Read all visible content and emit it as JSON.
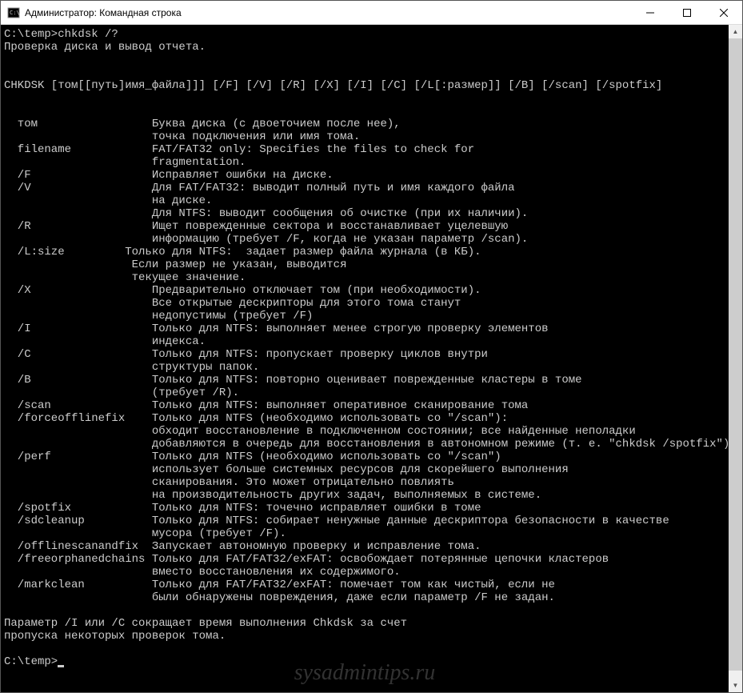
{
  "window": {
    "title": "Администратор: Командная строка"
  },
  "terminal": {
    "prompt1": "C:\\temp>chkdsk /?",
    "desc": "Проверка диска и вывод отчета.",
    "syntax": "CHKDSK [том[[путь]имя_файла]]] [/F] [/V] [/R] [/X] [/I] [/C] [/L[:размер]] [/B] [/scan] [/spotfix]",
    "params": [
      {
        "name": "  том",
        "desc": [
          "Буква диска (с двоеточием после нее),",
          "точка подключения или имя тома."
        ]
      },
      {
        "name": "  filename",
        "desc": [
          "FAT/FAT32 only: Specifies the files to check for",
          "fragmentation."
        ]
      },
      {
        "name": "  /F",
        "desc": [
          "Исправляет ошибки на диске."
        ]
      },
      {
        "name": "  /V",
        "desc": [
          "Для FAT/FAT32: выводит полный путь и имя каждого файла",
          "на диске.",
          "Для NTFS: выводит сообщения об очистке (при их наличии)."
        ]
      },
      {
        "name": "  /R",
        "desc": [
          "Ищет поврежденные сектора и восстанавливает уцелевшую",
          "информацию (требует /F, когда не указан параметр /scan)."
        ]
      },
      {
        "name": "  /L:size",
        "desc": [
          "Только для NTFS:  задает размер файла журнала (в КБ).",
          " Если размер не указан, выводится",
          " текущее значение."
        ],
        "col": 18
      },
      {
        "name": "  /X",
        "desc": [
          "Предварительно отключает том (при необходимости).",
          "Все открытые дескрипторы для этого тома станут",
          "недопустимы (требует /F)"
        ]
      },
      {
        "name": "  /I",
        "desc": [
          "Только для NTFS: выполняет менее строгую проверку элементов",
          "индекса."
        ]
      },
      {
        "name": "  /C",
        "desc": [
          "Только для NTFS: пропускает проверку циклов внутри",
          "структуры папок."
        ]
      },
      {
        "name": "  /B",
        "desc": [
          "Только для NTFS: повторно оценивает поврежденные кластеры в томе",
          "(требует /R)."
        ]
      },
      {
        "name": "  /scan",
        "desc": [
          "Только для NTFS: выполняет оперативное сканирование тома"
        ]
      },
      {
        "name": "  /forceofflinefix",
        "desc": [
          "Только для NTFS (необходимо использовать со \"/scan\"):",
          "обходит восстановление в подключенном состоянии; все найденные неполадки",
          "добавляются в очередь для восстановления в автономном режиме (т. е. \"chkdsk /spotfix\")."
        ]
      },
      {
        "name": "  /perf",
        "desc": [
          "Только для NTFS (необходимо использовать со \"/scan\")",
          "использует больше системных ресурсов для скорейшего выполнения",
          "сканирования. Это может отрицательно повлиять",
          "на производительность других задач, выполняемых в системе."
        ]
      },
      {
        "name": "  /spotfix",
        "desc": [
          "Только для NTFS: точечно исправляет ошибки в томе"
        ]
      },
      {
        "name": "  /sdcleanup",
        "desc": [
          "Только для NTFS: собирает ненужные данные дескриптора безопасности в качестве",
          "мусора (требует /F)."
        ]
      },
      {
        "name": "  /offlinescanandfix",
        "desc": [
          "Запускает автономную проверку и исправление тома."
        ]
      },
      {
        "name": "  /freeorphanedchains",
        "desc": [
          "Только для FAT/FAT32/exFAT: освобождает потерянные цепочки кластеров",
          "вместо восстановления их содержимого."
        ]
      },
      {
        "name": "  /markclean",
        "desc": [
          "Только для FAT/FAT32/exFAT: помечает том как чистый, если не",
          "были обнаружены повреждения, даже если параметр /F не задан."
        ]
      }
    ],
    "footer": [
      "Параметр /I или /C сокращает время выполнения Chkdsk за счет",
      "пропуска некоторых проверок тома."
    ],
    "prompt2": "C:\\temp>"
  },
  "watermark": "sysadmintips.ru"
}
